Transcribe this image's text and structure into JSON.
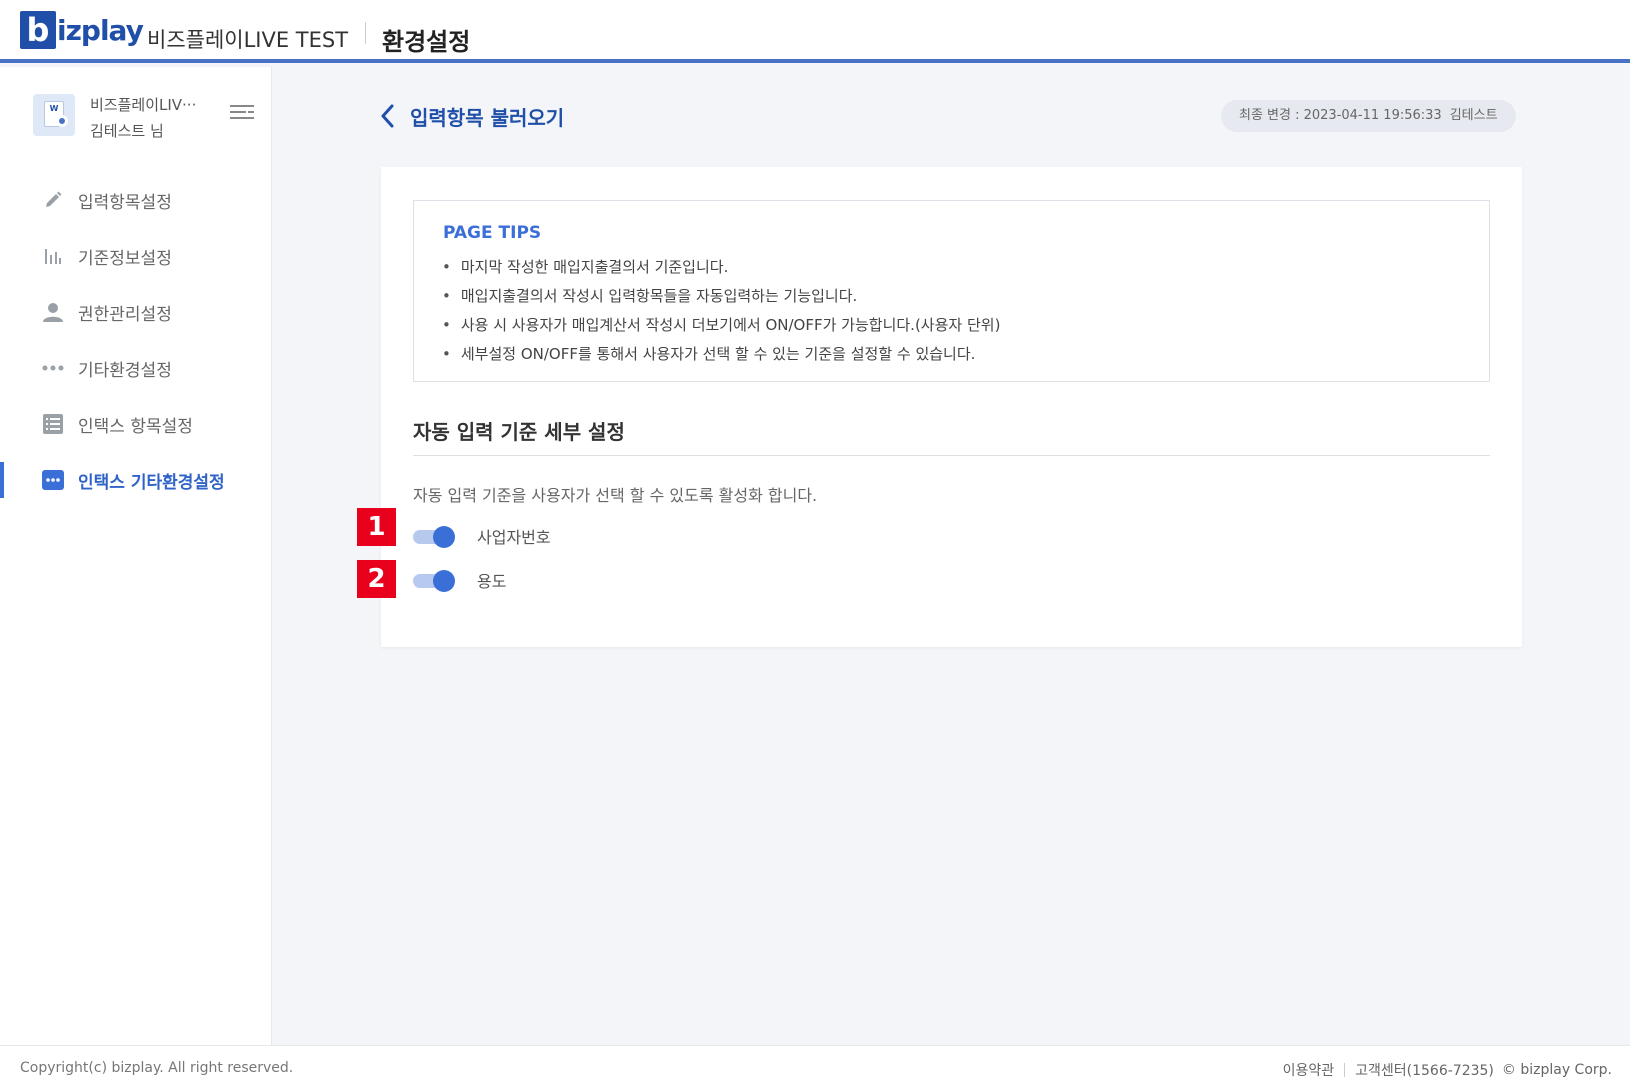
{
  "header": {
    "logo_b": "b",
    "logo_rest": "izplay",
    "company": "비즈플레이LIVE TEST",
    "title": "환경설정"
  },
  "sidebar": {
    "profile_name": "비즈플레이LIV···",
    "profile_user": "김테스트 님",
    "avatar_text": "W",
    "items": [
      {
        "label": "입력항목설정",
        "icon": "pencil-icon"
      },
      {
        "label": "기준정보설정",
        "icon": "bar-chart-icon"
      },
      {
        "label": "권한관리설정",
        "icon": "user-icon"
      },
      {
        "label": "기타환경설정",
        "icon": "more-dots-icon"
      },
      {
        "label": "인택스 항목설정",
        "icon": "list-icon"
      },
      {
        "label": "인택스 기타환경설정",
        "icon": "more-dots-box-icon",
        "active": true
      }
    ]
  },
  "main": {
    "page_title": "입력항목 불러오기",
    "last_modified_label": "최종 변경 : 2023-04-11 19:56:33",
    "last_modified_user": "김테스트",
    "tips": {
      "title": "PAGE TIPS",
      "items": [
        "마지막 작성한 매입지출결의서 기준입니다.",
        "매입지출결의서 작성시 입력항목들을 자동입력하는 기능입니다.",
        "사용 시 사용자가 매입계산서 작성시 더보기에서 ON/OFF가 가능합니다.(사용자 단위)",
        "세부설정 ON/OFF를 통해서 사용자가 선택 할 수 있는 기준을 설정할 수 있습니다."
      ]
    },
    "section_title": "자동 입력 기준 세부 설정",
    "section_desc": "자동 입력 기준을 사용자가 선택 할 수 있도록 활성화 합니다.",
    "toggles": [
      {
        "label": "사업자번호",
        "on": true,
        "marker": "1"
      },
      {
        "label": "용도",
        "on": true,
        "marker": "2"
      }
    ]
  },
  "footer": {
    "copyright": "Copyright(c) bizplay. All right reserved.",
    "terms": "이용약관",
    "support": "고객센터(1566-7235)",
    "corp": "© bizplay Corp."
  },
  "colors": {
    "brand": "#1f4fa8",
    "accent": "#3b6fd8",
    "marker": "#e8001c"
  }
}
